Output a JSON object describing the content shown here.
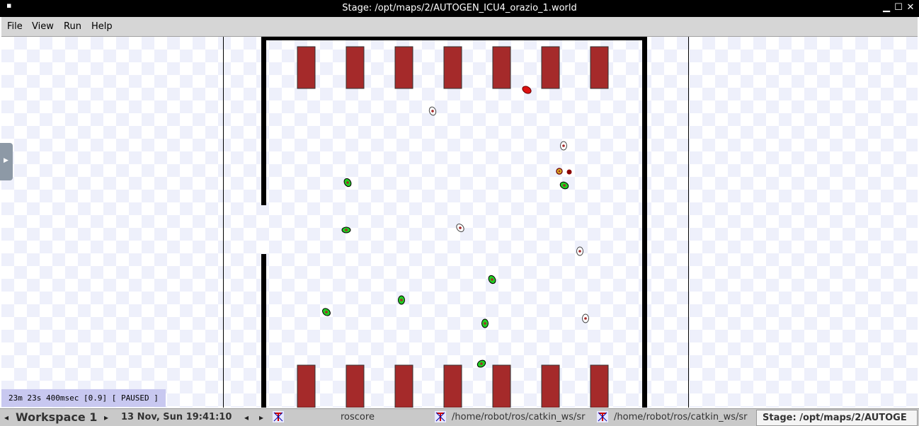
{
  "window": {
    "title": "Stage: /opt/maps/2/AUTOGEN_ICU4_orazio_1.world",
    "sysmenu_glyph": "▪",
    "minimize_glyph": "▁",
    "maximize_glyph": "☐",
    "close_glyph": "✕"
  },
  "menubar": {
    "items": [
      "File",
      "View",
      "Run",
      "Help"
    ]
  },
  "status": {
    "text": "23m 23s 400msec [0.9] [ PAUSED ]"
  },
  "side_handle": {
    "glyph": "▶"
  },
  "taskbar": {
    "workspace_label": "Workspace 1",
    "prev_glyph": "◂",
    "next_glyph": "▸",
    "clock": "13 Nov, Sun 19:41:10",
    "nav_prev": "◂",
    "nav_next": "▸",
    "tasks": [
      {
        "label": "roscore"
      },
      {
        "label": "/home/robot/ros/catkin_ws/sr"
      },
      {
        "label": "/home/robot/ros/catkin_ws/sr"
      },
      {
        "label": "Stage: /opt/maps/2/AUTOGE"
      }
    ]
  },
  "colors": {
    "bed": "#a52a2a",
    "robot_green": "#22cc22",
    "robot_white": "#ffffff",
    "robot_red": "#dd1111",
    "status_bg": "#c8c8f0",
    "wall": "#000000"
  }
}
